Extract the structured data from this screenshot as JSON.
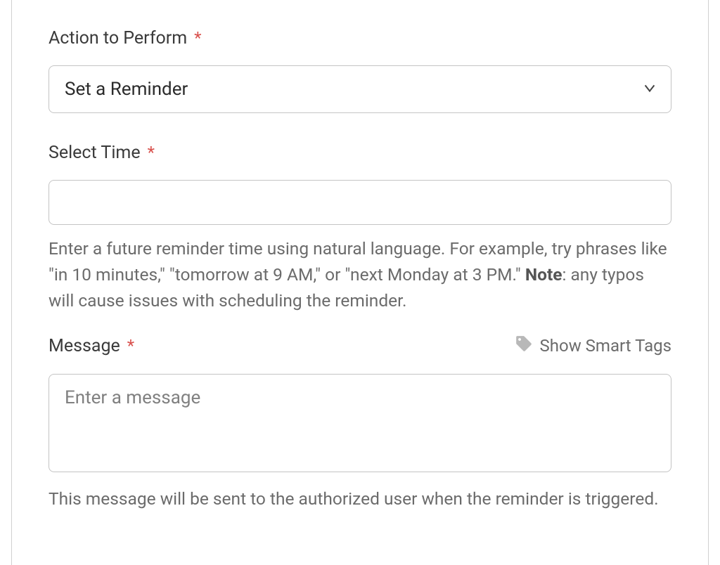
{
  "action": {
    "label": "Action to Perform",
    "required_mark": "*",
    "selected": "Set a Reminder"
  },
  "time": {
    "label": "Select Time",
    "required_mark": "*",
    "value": "",
    "help_main": "Enter a future reminder time using natural language. For example, try phrases like \"in 10 minutes,\" \"tomorrow at 9 AM,\" or \"next Monday at 3 PM.\" ",
    "help_note_label": "Note",
    "help_note_rest": ": any typos will cause issues with scheduling the reminder."
  },
  "message": {
    "label": "Message",
    "required_mark": "*",
    "smart_tags_label": "Show Smart Tags",
    "placeholder": "Enter a message",
    "help": "This message will be sent to the authorized user when the reminder is triggered."
  }
}
